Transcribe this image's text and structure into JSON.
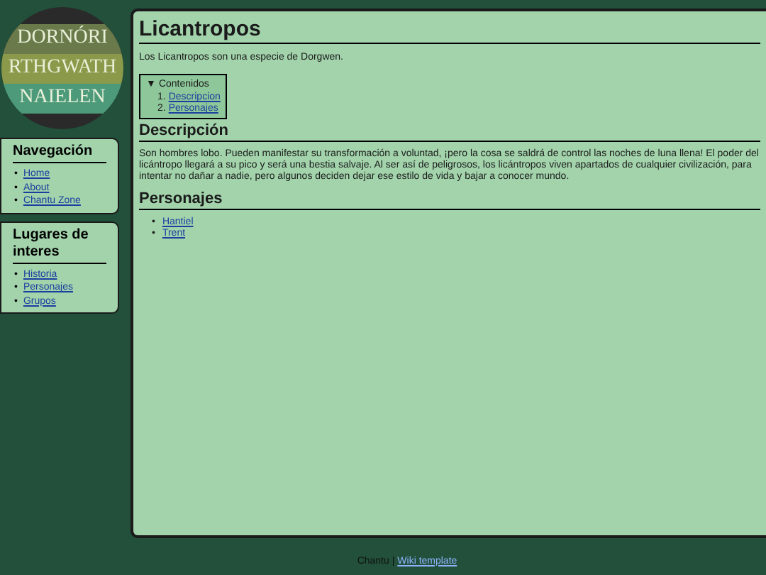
{
  "logo": {
    "lines": [
      "DORNÓRI",
      "RTHGWATH",
      "NAIELEN"
    ]
  },
  "bullet": "•",
  "sidebar": [
    {
      "title": "Navegación",
      "links": [
        "Home",
        "About",
        "Chantu Zone"
      ]
    },
    {
      "title": "Lugares de interes",
      "links": [
        "Historia",
        "Personajes",
        "Grupos"
      ]
    }
  ],
  "page": {
    "title": "Licantropos",
    "intro": "Los Licantropos son una especie de Dorgwen.",
    "toc": {
      "title": "Contenidos",
      "expanded": true,
      "toggle": "▼",
      "items": [
        {
          "number": "1.",
          "label": "Descripcion"
        },
        {
          "number": "2.",
          "label": "Personajes"
        }
      ]
    },
    "sections": [
      {
        "heading": "Descripción",
        "kind": "text",
        "text": "Son hombres lobo. Pueden manifestar su transformación a voluntad, ¡pero la cosa se saldrá de control las noches de luna llena! El poder del licántropo llegará a su pico y será una bestia salvaje. Al ser así de peligrosos, los licántropos viven apartados de cualquier civilización, para intentar no dañar a nadie, pero algunos deciden dejar ese estilo de vida y bajar a conocer mundo."
      },
      {
        "heading": "Personajes",
        "kind": "list",
        "items": [
          "Hantiel",
          "Trent"
        ]
      }
    ]
  },
  "footer": {
    "text": "Chantu |",
    "link": "Wiki template"
  }
}
